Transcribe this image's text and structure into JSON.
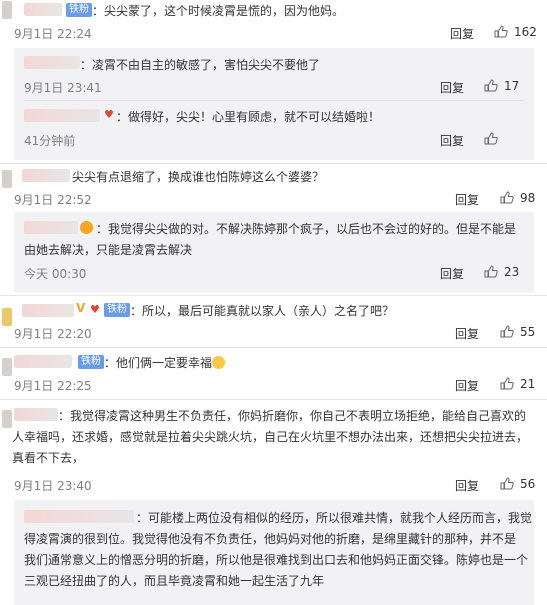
{
  "comments": [
    {
      "badge": "铁粉",
      "text": "：尖尖蒙了，这个时候凌霄是慌的，因为他妈。",
      "time": "9月1日 22:24",
      "reply": "回复",
      "likes": "162"
    },
    {
      "text": "：凌霄不由自主的敏感了，害怕尖尖不要他了",
      "time": "9月1日 23:41",
      "reply": "回复",
      "likes": "17"
    },
    {
      "text": "：做得好，尖尖！心里有顾虑，就不可以结婚啦！",
      "time": "41分钟前",
      "reply": "回复",
      "likes": ""
    },
    {
      "text": "尖尖有点退缩了，换成谁也怕陈婷这么个婆婆？",
      "time": "9月1日 22:52",
      "reply": "回复",
      "likes": "98"
    },
    {
      "text": "：我觉得尖尖做的对。不解决陈婷那个疯子，以后也不会过的好的。但是不能是",
      "text2": "由她去解决，只能是凌霄去解决",
      "time": "今天 00:30",
      "reply": "回复",
      "likes": "23"
    },
    {
      "badge": "铁粉",
      "text": "：所以，最后可能真就以家人（亲人）之名了吧？",
      "time": "9月1日 22:20",
      "reply": "回复",
      "likes": "55"
    },
    {
      "badge": "铁粉",
      "text": "：他们俩一定要幸福",
      "time": "9月1日 22:25",
      "reply": "回复",
      "likes": "21"
    },
    {
      "text": "：我觉得凌霄这种男生不负责任，你妈折磨你，你自己不表明立场拒绝，能给自己喜欢的",
      "text2": "人幸福吗，还求婚，感觉就是拉着尖尖跳火坑，自己在火坑里不想办法出来，还想把尖尖拉进去，",
      "text3": "真看不下去，",
      "time": "9月1日 23:40",
      "reply": "回复",
      "likes": "56"
    },
    {
      "text": "：可能楼上两位没有相似的经历，所以很难共情，就我个人经历而言，我觉",
      "text2": "得凌霄演的很到位。我觉得他没有不负责任，他妈妈对他的折磨，是绵里藏针的那种，并不是",
      "text3": "我们通常意义上的憎恶分明的折磨，所以他是很难找到出口去和他妈妈正面交锋。陈婷也是一个",
      "text4": "三观已经扭曲了的人，而且毕竟凌霄和她一起生活了九年"
    }
  ],
  "icons": {
    "like": "thumbs-up-icon",
    "emoji": "crying-face-icon",
    "vip": "vip-v-icon",
    "heart": "heart-icon"
  }
}
